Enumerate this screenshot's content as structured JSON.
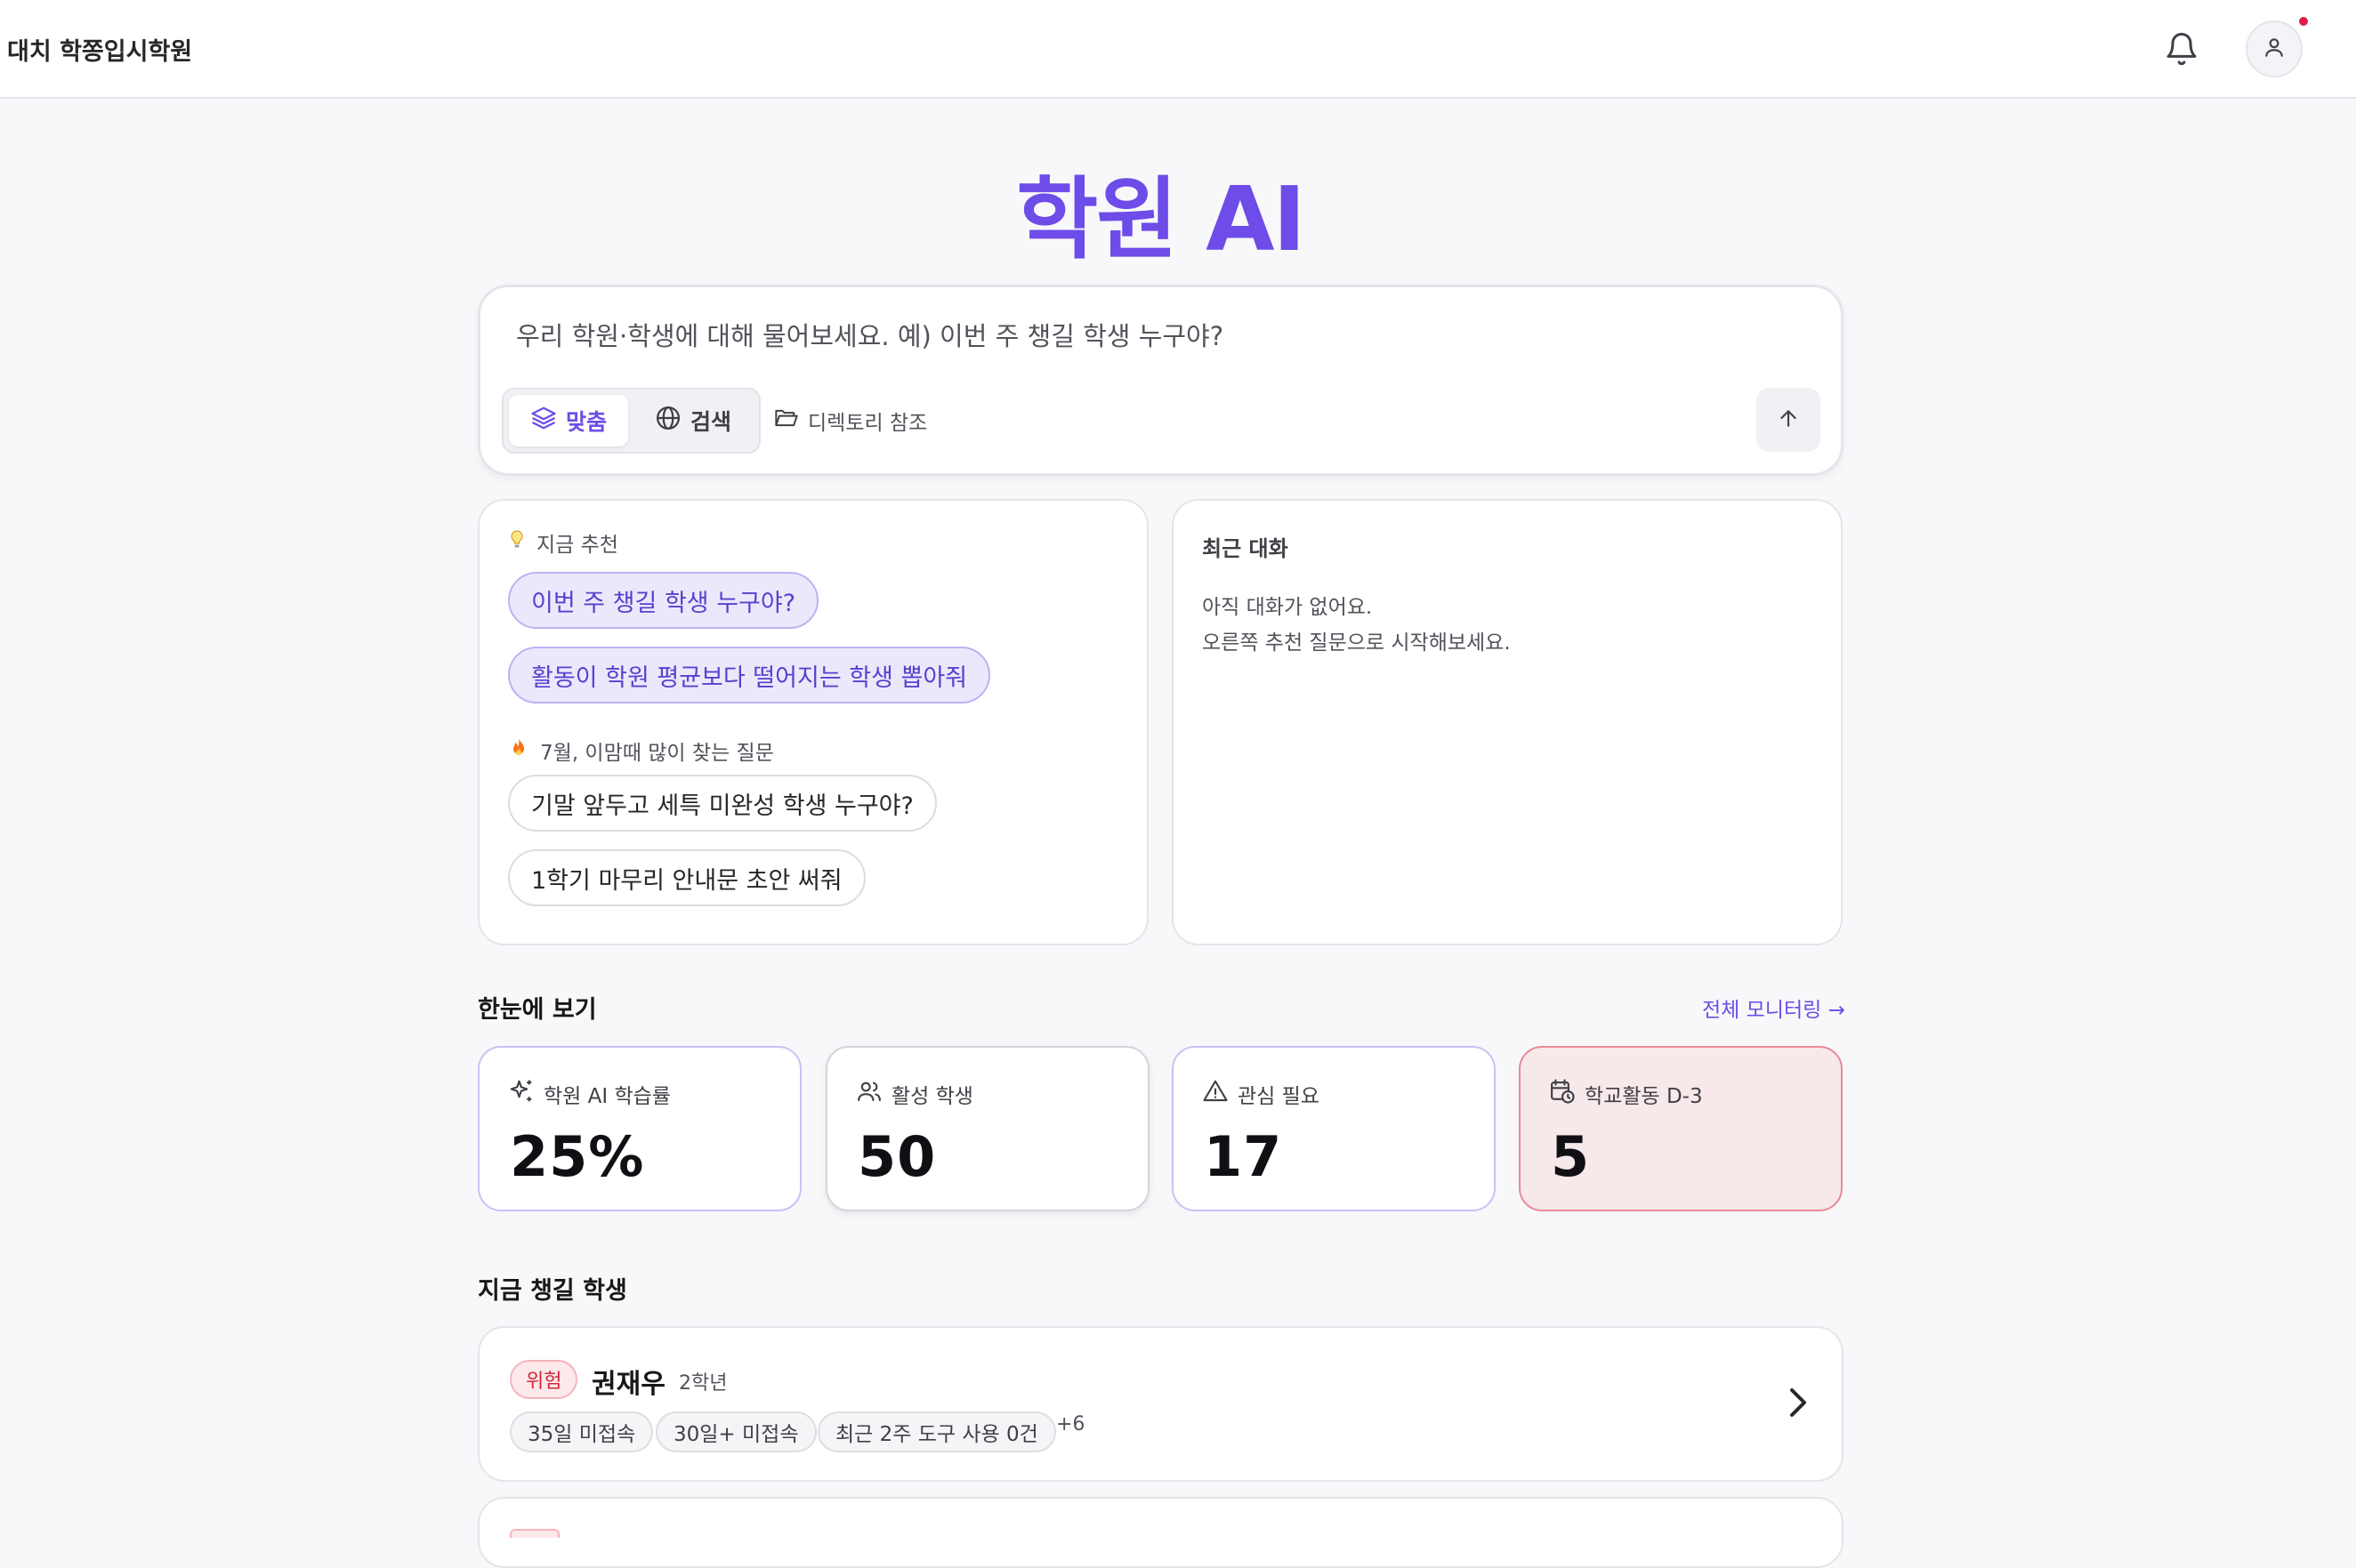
{
  "header": {
    "academy_name": "대치 학쫑입시학원",
    "icons": [
      "bell-icon",
      "user-icon"
    ],
    "has_notification": true
  },
  "hero": {
    "title": "학원 AI"
  },
  "composer": {
    "placeholder": "우리 학원·학생에 대해 물어보세요. 예) 이번 주 챙길 학생 누구야?",
    "value": "",
    "modes": [
      {
        "label": "맞춤",
        "icon": "layers-icon",
        "active": true
      },
      {
        "label": "검색",
        "icon": "globe-icon",
        "active": false
      }
    ],
    "directory_label": "디렉토리 참조",
    "send_icon": "arrow-up-icon"
  },
  "suggestions": {
    "now_label": "지금 추천",
    "now_items": [
      "이번 주 챙길 학생 누구야?",
      "활동이 학원 평균보다 떨어지는 학생 뽑아줘"
    ],
    "popular_label": "7월, 이맘때 많이 찾는 질문",
    "popular_items": [
      "기말 앞두고 세특 미완성 학생 누구야?",
      "1학기 마무리 안내문 초안 써줘"
    ]
  },
  "recent": {
    "title": "최근 대화",
    "empty_line1": "아직 대화가 없어요.",
    "empty_line2": "오른쪽 추천 질문으로 시작해보세요."
  },
  "glance": {
    "title": "한눈에 보기",
    "link": "전체 모니터링 →",
    "stats": [
      {
        "label": "학원 AI 학습률",
        "value": "25%",
        "icon": "sparkles-icon"
      },
      {
        "label": "활성 학생",
        "value": "50",
        "icon": "users-icon"
      },
      {
        "label": "관심 필요",
        "value": "17",
        "icon": "alert-triangle-icon"
      },
      {
        "label": "학교활동 D-3",
        "value": "5",
        "icon": "calendar-clock-icon",
        "highlight": "#f7e8ea"
      }
    ]
  },
  "care": {
    "title": "지금 챙길 학생",
    "students": [
      {
        "badge": "위험",
        "name": "권재우",
        "grade": "2학년",
        "tags": [
          "35일 미접속",
          "30일+ 미접속",
          "최근 2주 도구 사용 0건"
        ],
        "more": "+6"
      }
    ]
  },
  "colors": {
    "accent": "#6d4ce8",
    "danger": "#d1283a",
    "danger_bg": "#fde8ea"
  }
}
